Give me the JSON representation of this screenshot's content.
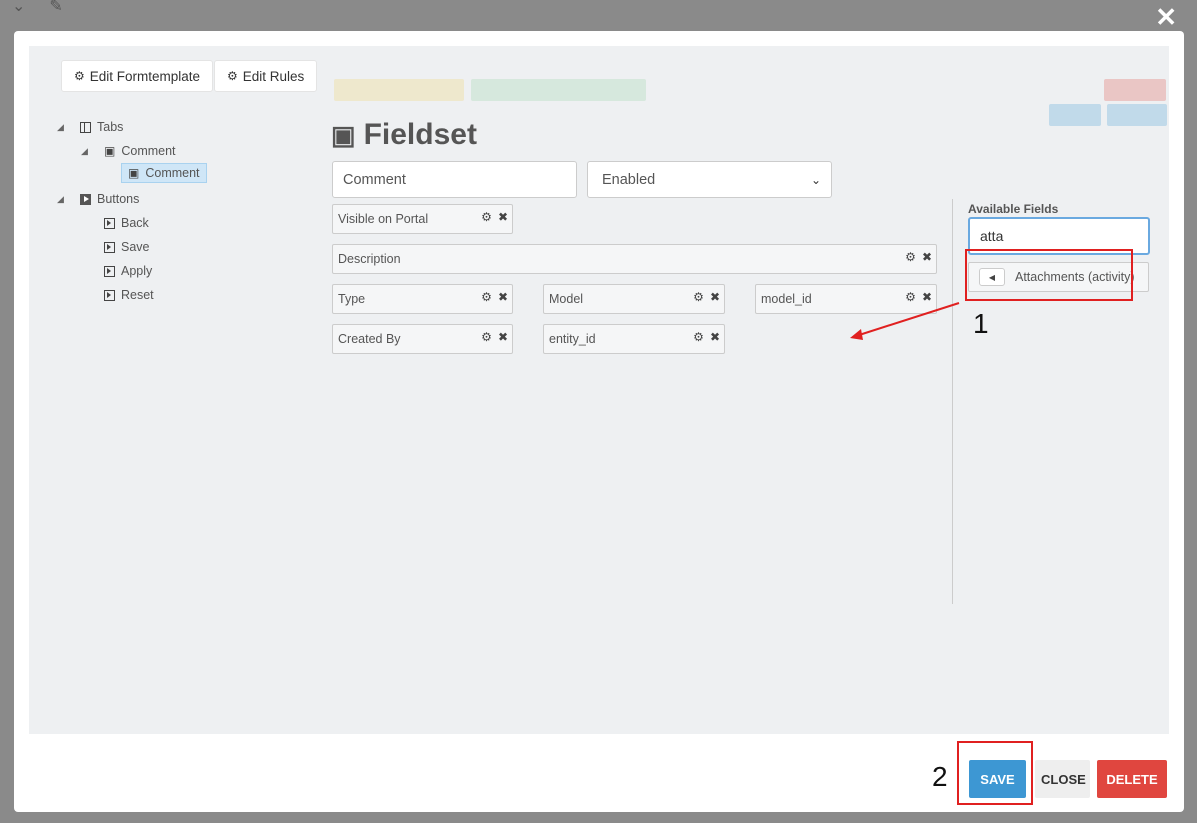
{
  "background": {
    "top_icons": [
      "chevron-down-icon",
      "edit-icon"
    ],
    "close_glyph": "✕"
  },
  "toolbar": {
    "edit_formtemplate": "Edit Formtemplate",
    "edit_rules": "Edit Rules"
  },
  "tree": {
    "tabs": "Tabs",
    "comment_group": "Comment",
    "comment_selected": "Comment",
    "buttons": "Buttons",
    "back": "Back",
    "save": "Save",
    "apply": "Apply",
    "reset": "Reset"
  },
  "fieldset": {
    "title": "Fieldset",
    "name_value": "Comment",
    "status_value": "Enabled"
  },
  "fields": {
    "visible_on_portal": "Visible on Portal",
    "description": "Description",
    "type": "Type",
    "model": "Model",
    "model_id": "model_id",
    "created_by": "Created By",
    "entity_id": "entity_id"
  },
  "available": {
    "title": "Available Fields",
    "search_value": "atta",
    "item": "Attachments (activity)"
  },
  "annotations": {
    "n1": "1",
    "n2": "2",
    "color": "#e02020"
  },
  "footer": {
    "save": "SAVE",
    "close": "CLOSE",
    "delete": "DELETE"
  },
  "colors": {
    "save": "#3d97d3",
    "delete": "#e0463f",
    "selected": "#cfe6f7"
  }
}
